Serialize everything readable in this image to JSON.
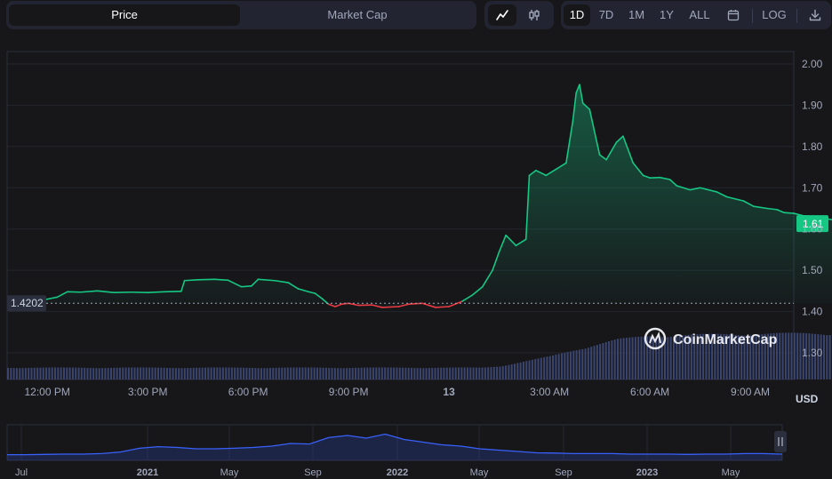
{
  "tabs": {
    "price": "Price",
    "market_cap": "Market Cap"
  },
  "chart_mode": {
    "line": "line-chart-icon",
    "candle": "candlestick-icon",
    "active": "line"
  },
  "ranges": [
    "1D",
    "7D",
    "1M",
    "1Y",
    "ALL"
  ],
  "active_range": "1D",
  "log_label": "LOG",
  "currency": "USD",
  "watermark": "CoinMarketCap",
  "colors": {
    "up": "#16c784",
    "down": "#ea3943",
    "volume": "#3b4670",
    "nav_line": "#3861fb",
    "bg": "#17171a"
  },
  "chart_data": {
    "type": "line",
    "ylim": [
      1.25,
      2.05
    ],
    "yticks": [
      2.0,
      1.9,
      1.8,
      1.7,
      1.6,
      1.5,
      1.4,
      1.3
    ],
    "open_price": 1.4202,
    "open_price_label": "1.4202",
    "current_price_label": "1.61",
    "x_ticks": [
      "12:00 PM",
      "3:00 PM",
      "6:00 PM",
      "9:00 PM",
      "13",
      "3:00 AM",
      "6:00 AM",
      "9:00 AM"
    ],
    "x_hours": [
      0,
      3,
      6,
      9,
      12,
      15,
      18,
      21
    ],
    "x_range_hours": [
      -1.2,
      22.3
    ],
    "price_series": [
      [
        -0.5,
        1.427
      ],
      [
        0.0,
        1.43
      ],
      [
        0.3,
        1.435
      ],
      [
        0.6,
        1.448
      ],
      [
        1.0,
        1.447
      ],
      [
        1.5,
        1.45
      ],
      [
        2.0,
        1.446
      ],
      [
        2.5,
        1.447
      ],
      [
        3.0,
        1.446
      ],
      [
        3.5,
        1.448
      ],
      [
        4.0,
        1.449
      ],
      [
        4.1,
        1.475
      ],
      [
        4.5,
        1.477
      ],
      [
        5.0,
        1.478
      ],
      [
        5.4,
        1.476
      ],
      [
        5.8,
        1.46
      ],
      [
        6.1,
        1.462
      ],
      [
        6.3,
        1.478
      ],
      [
        6.8,
        1.475
      ],
      [
        7.2,
        1.47
      ],
      [
        7.5,
        1.455
      ],
      [
        7.8,
        1.448
      ],
      [
        8.0,
        1.444
      ],
      [
        8.2,
        1.432
      ],
      [
        8.4,
        1.418
      ],
      [
        8.6,
        1.412
      ],
      [
        8.8,
        1.418
      ],
      [
        9.0,
        1.42
      ],
      [
        9.3,
        1.415
      ],
      [
        9.7,
        1.416
      ],
      [
        10.0,
        1.41
      ],
      [
        10.5,
        1.412
      ],
      [
        10.8,
        1.418
      ],
      [
        11.2,
        1.42
      ],
      [
        11.6,
        1.41
      ],
      [
        12.0,
        1.412
      ],
      [
        12.4,
        1.425
      ],
      [
        12.7,
        1.44
      ],
      [
        13.0,
        1.46
      ],
      [
        13.3,
        1.5
      ],
      [
        13.5,
        1.545
      ],
      [
        13.7,
        1.585
      ],
      [
        14.0,
        1.56
      ],
      [
        14.3,
        1.575
      ],
      [
        14.4,
        1.73
      ],
      [
        14.6,
        1.742
      ],
      [
        14.9,
        1.73
      ],
      [
        15.2,
        1.745
      ],
      [
        15.5,
        1.76
      ],
      [
        15.7,
        1.862
      ],
      [
        15.8,
        1.93
      ],
      [
        15.9,
        1.95
      ],
      [
        16.0,
        1.905
      ],
      [
        16.2,
        1.89
      ],
      [
        16.5,
        1.78
      ],
      [
        16.7,
        1.768
      ],
      [
        17.0,
        1.81
      ],
      [
        17.2,
        1.825
      ],
      [
        17.5,
        1.76
      ],
      [
        17.8,
        1.73
      ],
      [
        18.0,
        1.724
      ],
      [
        18.3,
        1.725
      ],
      [
        18.6,
        1.72
      ],
      [
        18.8,
        1.705
      ],
      [
        19.2,
        1.695
      ],
      [
        19.5,
        1.7
      ],
      [
        19.7,
        1.696
      ],
      [
        20.0,
        1.69
      ],
      [
        20.3,
        1.678
      ],
      [
        20.8,
        1.668
      ],
      [
        21.1,
        1.655
      ],
      [
        21.5,
        1.65
      ],
      [
        21.8,
        1.647
      ],
      [
        22.0,
        1.64
      ],
      [
        22.3,
        1.638
      ],
      [
        22.6,
        1.632
      ],
      [
        22.9,
        1.63
      ],
      [
        23.2,
        1.626
      ],
      [
        23.5,
        1.622
      ],
      [
        23.7,
        1.612
      ]
    ],
    "volume_relative": {
      "hours": [
        -1.2,
        13.0,
        13.5,
        14.0,
        15.0,
        16.0,
        17.0,
        18.0,
        20.0,
        22.6,
        23.7
      ],
      "levels": [
        0.23,
        0.23,
        0.26,
        0.32,
        0.45,
        0.62,
        0.78,
        0.85,
        0.88,
        0.9,
        0.9
      ]
    }
  },
  "navigator": {
    "labels": [
      "Jul",
      "2021",
      "May",
      "Sep",
      "2022",
      "May",
      "Sep",
      "2023",
      "May"
    ],
    "series_relative": [
      0.08,
      0.08,
      0.09,
      0.1,
      0.1,
      0.12,
      0.18,
      0.32,
      0.38,
      0.35,
      0.3,
      0.3,
      0.32,
      0.35,
      0.4,
      0.5,
      0.48,
      0.72,
      0.8,
      0.7,
      0.85,
      0.65,
      0.55,
      0.45,
      0.4,
      0.3,
      0.25,
      0.2,
      0.15,
      0.14,
      0.12,
      0.12,
      0.12,
      0.1,
      0.1,
      0.1,
      0.09,
      0.1,
      0.1,
      0.12,
      0.12,
      0.1
    ]
  }
}
